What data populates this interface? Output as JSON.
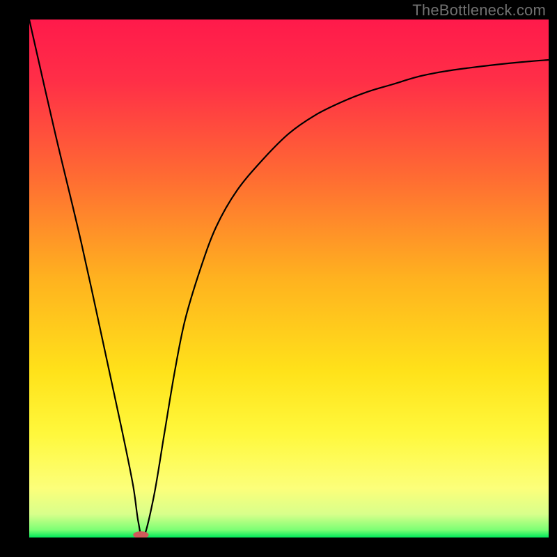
{
  "watermark": "TheBottleneck.com",
  "chart_data": {
    "type": "line",
    "title": "",
    "xlabel": "",
    "ylabel": "",
    "xlim": [
      0,
      100
    ],
    "ylim": [
      0,
      100
    ],
    "gradient_stops": [
      {
        "offset": 0.0,
        "color": "#ff1a4b"
      },
      {
        "offset": 0.12,
        "color": "#ff2f47"
      },
      {
        "offset": 0.3,
        "color": "#ff6a33"
      },
      {
        "offset": 0.5,
        "color": "#ffb21f"
      },
      {
        "offset": 0.68,
        "color": "#ffe21a"
      },
      {
        "offset": 0.8,
        "color": "#fff83c"
      },
      {
        "offset": 0.905,
        "color": "#fcff7a"
      },
      {
        "offset": 0.955,
        "color": "#d8ff8b"
      },
      {
        "offset": 0.985,
        "color": "#7dff75"
      },
      {
        "offset": 1.0,
        "color": "#00e85a"
      }
    ],
    "series": [
      {
        "name": "curve",
        "color": "#000000",
        "x": [
          0,
          5,
          10,
          15,
          18,
          20,
          21,
          22,
          24,
          26,
          28,
          30,
          33,
          36,
          40,
          45,
          50,
          55,
          60,
          65,
          70,
          75,
          80,
          85,
          90,
          95,
          100
        ],
        "values": [
          100,
          78,
          57,
          34,
          20,
          10,
          3,
          0,
          8,
          20,
          32,
          42,
          52,
          60,
          67,
          73,
          78,
          81.5,
          84,
          86,
          87.5,
          89,
          90,
          90.7,
          91.3,
          91.8,
          92.2
        ]
      }
    ],
    "marker": {
      "x": 21.5,
      "y": 0.5,
      "rx": 1.5,
      "ry": 0.7,
      "color": "#cf5a5a"
    }
  }
}
